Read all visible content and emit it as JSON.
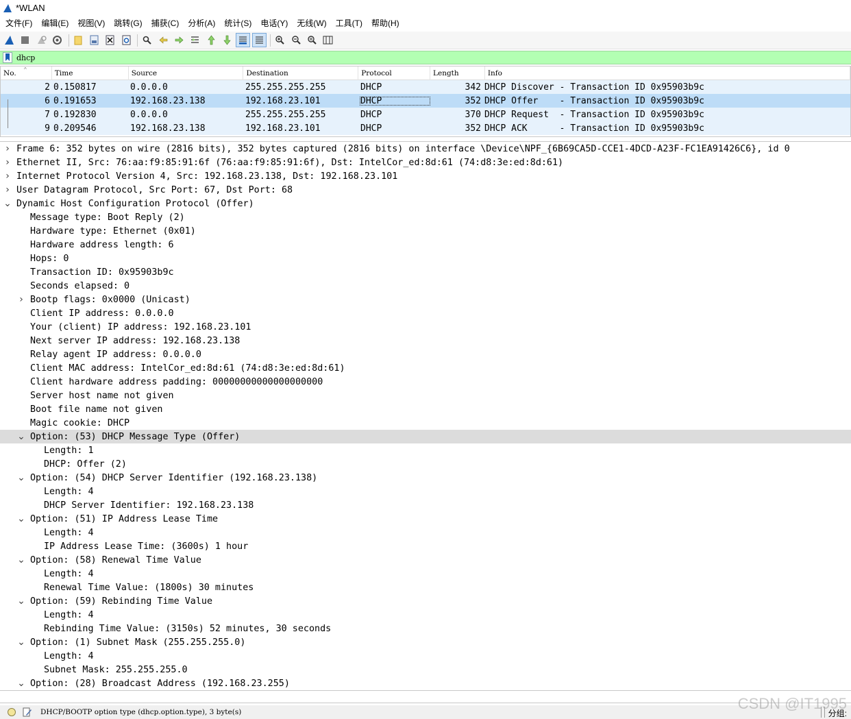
{
  "window": {
    "title": "*WLAN"
  },
  "menu": [
    "文件(F)",
    "编辑(E)",
    "视图(V)",
    "跳转(G)",
    "捕获(C)",
    "分析(A)",
    "统计(S)",
    "电话(Y)",
    "无线(W)",
    "工具(T)",
    "帮助(H)"
  ],
  "toolbar": {
    "buttons": [
      "shark-fin-start-icon",
      "stop-icon",
      "restart-icon",
      "options-gear-icon",
      "open-folder-icon",
      "save-file-icon",
      "close-file-icon",
      "reload-icon",
      "find-icon",
      "back-arrow-icon",
      "forward-arrow-icon",
      "go-to-packet-icon",
      "first-packet-icon",
      "last-packet-icon",
      "autoscroll-icon",
      "colorize-icon",
      "zoom-in-icon",
      "zoom-out-icon",
      "zoom-normal-icon",
      "resize-columns-icon"
    ]
  },
  "filter": {
    "value": "dhcp",
    "bg_color": "#b3ffb3"
  },
  "packet_list": {
    "columns": [
      "No.",
      "Time",
      "Source",
      "Destination",
      "Protocol",
      "Length",
      "Info"
    ],
    "rows": [
      {
        "no": "2",
        "time": "0.150817",
        "src": "0.0.0.0",
        "dst": "255.255.255.255",
        "proto": "DHCP",
        "len": "342",
        "info": "DHCP Discover - Transaction ID 0x95903b9c",
        "selected": false
      },
      {
        "no": "6",
        "time": "0.191653",
        "src": "192.168.23.138",
        "dst": "192.168.23.101",
        "proto": "DHCP",
        "len": "352",
        "info": "DHCP Offer    - Transaction ID 0x95903b9c",
        "selected": true
      },
      {
        "no": "7",
        "time": "0.192830",
        "src": "0.0.0.0",
        "dst": "255.255.255.255",
        "proto": "DHCP",
        "len": "370",
        "info": "DHCP Request  - Transaction ID 0x95903b9c",
        "selected": false
      },
      {
        "no": "9",
        "time": "0.209546",
        "src": "192.168.23.138",
        "dst": "192.168.23.101",
        "proto": "DHCP",
        "len": "352",
        "info": "DHCP ACK      - Transaction ID 0x95903b9c",
        "selected": false
      }
    ]
  },
  "details": [
    {
      "level": 0,
      "toggle": "collapsed",
      "text": "Frame 6: 352 bytes on wire (2816 bits), 352 bytes captured (2816 bits) on interface \\Device\\NPF_{6B69CA5D-CCE1-4DCD-A23F-FC1EA91426C6}, id 0"
    },
    {
      "level": 0,
      "toggle": "collapsed",
      "text": "Ethernet II, Src: 76:aa:f9:85:91:6f (76:aa:f9:85:91:6f), Dst: IntelCor_ed:8d:61 (74:d8:3e:ed:8d:61)"
    },
    {
      "level": 0,
      "toggle": "collapsed",
      "text": "Internet Protocol Version 4, Src: 192.168.23.138, Dst: 192.168.23.101"
    },
    {
      "level": 0,
      "toggle": "collapsed",
      "text": "User Datagram Protocol, Src Port: 67, Dst Port: 68"
    },
    {
      "level": 0,
      "toggle": "expanded",
      "text": "Dynamic Host Configuration Protocol (Offer)"
    },
    {
      "level": 1,
      "toggle": "",
      "text": "Message type: Boot Reply (2)"
    },
    {
      "level": 1,
      "toggle": "",
      "text": "Hardware type: Ethernet (0x01)"
    },
    {
      "level": 1,
      "toggle": "",
      "text": "Hardware address length: 6"
    },
    {
      "level": 1,
      "toggle": "",
      "text": "Hops: 0"
    },
    {
      "level": 1,
      "toggle": "",
      "text": "Transaction ID: 0x95903b9c"
    },
    {
      "level": 1,
      "toggle": "",
      "text": "Seconds elapsed: 0"
    },
    {
      "level": 1,
      "toggle": "collapsed",
      "text": "Bootp flags: 0x0000 (Unicast)"
    },
    {
      "level": 1,
      "toggle": "",
      "text": "Client IP address: 0.0.0.0"
    },
    {
      "level": 1,
      "toggle": "",
      "text": "Your (client) IP address: 192.168.23.101"
    },
    {
      "level": 1,
      "toggle": "",
      "text": "Next server IP address: 192.168.23.138"
    },
    {
      "level": 1,
      "toggle": "",
      "text": "Relay agent IP address: 0.0.0.0"
    },
    {
      "level": 1,
      "toggle": "",
      "text": "Client MAC address: IntelCor_ed:8d:61 (74:d8:3e:ed:8d:61)"
    },
    {
      "level": 1,
      "toggle": "",
      "text": "Client hardware address padding: 00000000000000000000"
    },
    {
      "level": 1,
      "toggle": "",
      "text": "Server host name not given"
    },
    {
      "level": 1,
      "toggle": "",
      "text": "Boot file name not given"
    },
    {
      "level": 1,
      "toggle": "",
      "text": "Magic cookie: DHCP"
    },
    {
      "level": 1,
      "toggle": "expanded",
      "text": "Option: (53) DHCP Message Type (Offer)",
      "highlight": true
    },
    {
      "level": 2,
      "toggle": "",
      "text": "Length: 1"
    },
    {
      "level": 2,
      "toggle": "",
      "text": "DHCP: Offer (2)"
    },
    {
      "level": 1,
      "toggle": "expanded",
      "text": "Option: (54) DHCP Server Identifier (192.168.23.138)"
    },
    {
      "level": 2,
      "toggle": "",
      "text": "Length: 4"
    },
    {
      "level": 2,
      "toggle": "",
      "text": "DHCP Server Identifier: 192.168.23.138"
    },
    {
      "level": 1,
      "toggle": "expanded",
      "text": "Option: (51) IP Address Lease Time"
    },
    {
      "level": 2,
      "toggle": "",
      "text": "Length: 4"
    },
    {
      "level": 2,
      "toggle": "",
      "text": "IP Address Lease Time: (3600s) 1 hour"
    },
    {
      "level": 1,
      "toggle": "expanded",
      "text": "Option: (58) Renewal Time Value"
    },
    {
      "level": 2,
      "toggle": "",
      "text": "Length: 4"
    },
    {
      "level": 2,
      "toggle": "",
      "text": "Renewal Time Value: (1800s) 30 minutes"
    },
    {
      "level": 1,
      "toggle": "expanded",
      "text": "Option: (59) Rebinding Time Value"
    },
    {
      "level": 2,
      "toggle": "",
      "text": "Length: 4"
    },
    {
      "level": 2,
      "toggle": "",
      "text": "Rebinding Time Value: (3150s) 52 minutes, 30 seconds"
    },
    {
      "level": 1,
      "toggle": "expanded",
      "text": "Option: (1) Subnet Mask (255.255.255.0)"
    },
    {
      "level": 2,
      "toggle": "",
      "text": "Length: 4"
    },
    {
      "level": 2,
      "toggle": "",
      "text": "Subnet Mask: 255.255.255.0"
    },
    {
      "level": 1,
      "toggle": "expanded",
      "text": "Option: (28) Broadcast Address (192.168.23.255)"
    }
  ],
  "statusbar": {
    "field_info": "DHCP/BOOTP option type (dhcp.option.type), 3 byte(s)",
    "packets_label": "分组:"
  },
  "watermark": "CSDN @IT1995",
  "colors": {
    "row_bg": "#e7f2fc",
    "row_selected": "#bddcf7",
    "detail_highlight": "#dcdcdc",
    "filter_ok": "#b3ffb3"
  }
}
